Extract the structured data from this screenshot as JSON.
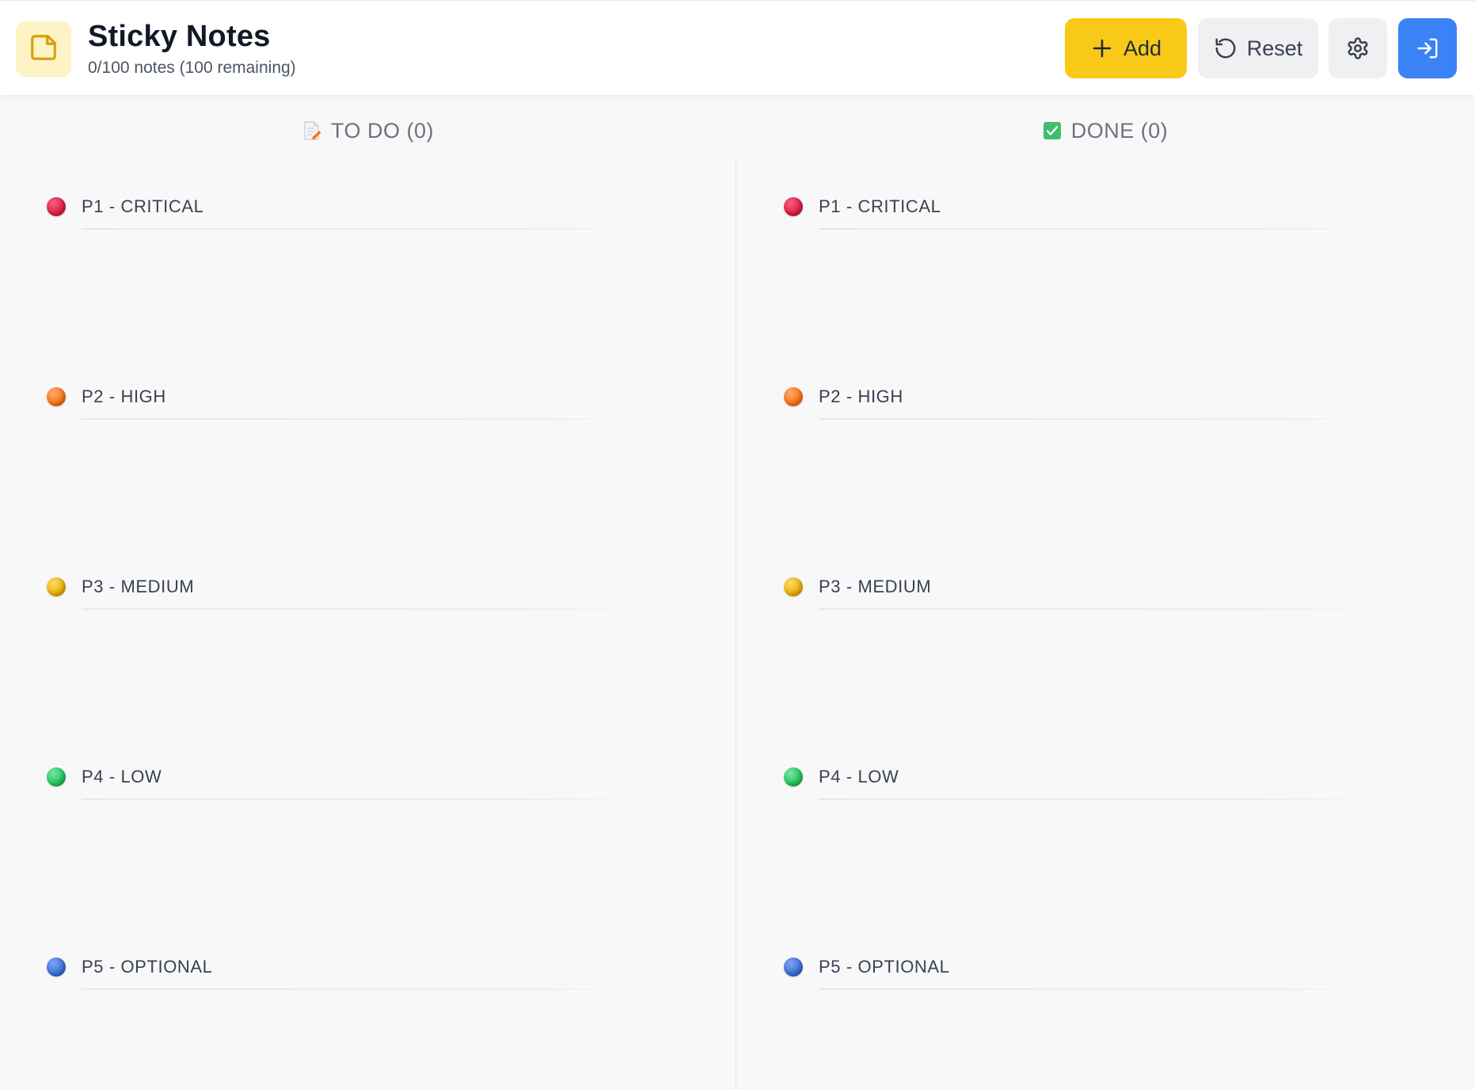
{
  "header": {
    "title": "Sticky Notes",
    "subtitle": "0/100 notes (100 remaining)",
    "add_label": "Add",
    "reset_label": "Reset",
    "icons": {
      "logo": "sticky-note-icon",
      "add": "plus-icon",
      "reset": "rotate-ccw-icon",
      "settings": "gear-icon",
      "login": "log-in-icon"
    }
  },
  "colors": {
    "accent_yellow": "#f9c918",
    "login_blue": "#3b82f6",
    "p1": "#e11d48",
    "p2": "#f97316",
    "p3": "#eab308",
    "p4": "#22c55e",
    "p5": "#3b6fd8"
  },
  "columns": [
    {
      "title": "TO DO",
      "count": "(0)",
      "icon": "memo-icon",
      "groups": [
        {
          "label": "P1 - CRITICAL"
        },
        {
          "label": "P2 - HIGH"
        },
        {
          "label": "P3 - MEDIUM"
        },
        {
          "label": "P4 - LOW"
        },
        {
          "label": "P5 - OPTIONAL"
        }
      ]
    },
    {
      "title": "DONE",
      "count": "(0)",
      "icon": "check-box-icon",
      "groups": [
        {
          "label": "P1 - CRITICAL"
        },
        {
          "label": "P2 - HIGH"
        },
        {
          "label": "P3 - MEDIUM"
        },
        {
          "label": "P4 - LOW"
        },
        {
          "label": "P5 - OPTIONAL"
        }
      ]
    }
  ]
}
